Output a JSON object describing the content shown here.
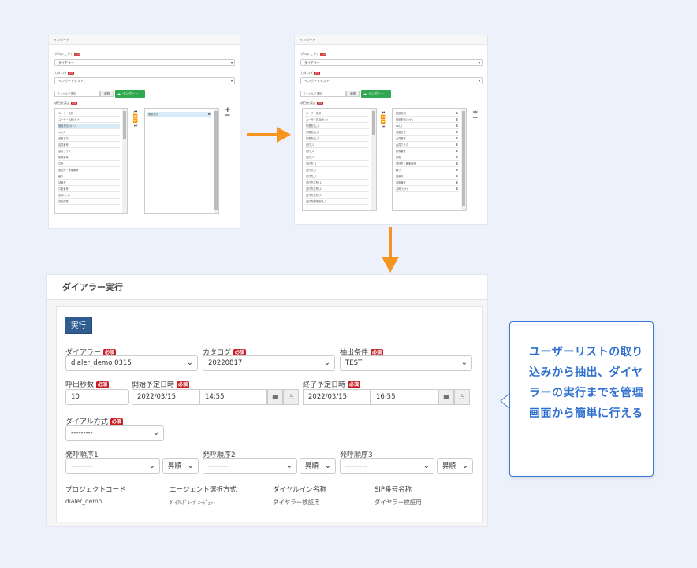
{
  "screen1": {
    "header": "インポート",
    "project_label": "プロジェクト",
    "project_value": "ダイヤラー",
    "catalog_label": "カタログ",
    "catalog_value": "インポートテスト",
    "required": "必須",
    "file_placeholder": "ファイルを選択",
    "browse_label": "参照",
    "import_label": "インポート",
    "mapping_label": "項目を設定",
    "left_items": [
      "ユーザー名称",
      "ユーザー名称(カナ)",
      "施設担当(カナ)",
      "col_1",
      "送客日付",
      "会員番号",
      "会員フラグ",
      "新規番号",
      "住所",
      "発送先・郵便番号",
      "繰り",
      "請番号",
      "口座番号",
      "名称(カナ)",
      "前会所属"
    ],
    "right_items": [
      "施設担当"
    ]
  },
  "screen2": {
    "header": "インポート",
    "project_label": "プロジェクト",
    "project_value": "ダイヤラー",
    "catalog_label": "カタログ",
    "catalog_value": "インポートテスト",
    "required": "必須",
    "file_placeholder": "ファイルを選択",
    "browse_label": "参照",
    "import_label": "インポート",
    "mapping_label": "項目を設定",
    "left_items": [
      "ユーザー名称",
      "ユーザー名称(カナ)",
      "所属担当_1",
      "所属担当_2",
      "所属担当_3",
      "日付_1",
      "日付_2",
      "日付_3",
      "送付先_1",
      "送付先_2",
      "送付先_3",
      "送付先住所_1",
      "送付先住所_2",
      "送付先住所_3",
      "送付先郵便番号_1"
    ],
    "right_items": [
      "施設担当",
      "施設担当(カナ)",
      "col_1",
      "送客日付",
      "会員番号",
      "会員フラグ",
      "新規番号",
      "住所",
      "発送先・郵便番号",
      "繰り",
      "請番号",
      "口座番号",
      "名称(カナ)"
    ]
  },
  "main": {
    "title": "ダイアラー実行",
    "run_button": "実行",
    "required": "必須",
    "dialer_label": "ダイアラー",
    "dialer_value": "dialer_demo 0315",
    "catalog_label": "カタログ",
    "catalog_value": "20220817",
    "condition_label": "抽出条件",
    "condition_value": "TEST",
    "call_seconds_label": "呼出秒数",
    "call_seconds_value": "10",
    "start_label": "開始予定日時",
    "start_date": "2022/03/15",
    "start_time": "14:55",
    "end_label": "終了予定日時",
    "end_date": "2022/03/15",
    "end_time": "16:55",
    "dial_method_label": "ダイアル方式",
    "dial_method_value": "---------",
    "order1_label": "発呼順序1",
    "order2_label": "発呼順序2",
    "order3_label": "発呼順序3",
    "order_value": "---------",
    "order_dir": "昇順",
    "project_code_label": "プロジェクトコード",
    "project_code_value": "dialer_demo",
    "agent_method_label": "エージェント選択方式",
    "agent_method_value": "ﾀﾞｲｱﾙｸﾞﾙｰﾌﾟｴｰｼﾞｪﾝﾄ",
    "dial_in_label": "ダイヤルイン名称",
    "dial_in_value": "ダイヤラー検証用",
    "sip_label": "SIP番号名称",
    "sip_value": "ダイヤラー検証用"
  },
  "callout": {
    "text": "ユーザーリストの取り込みから抽出、ダイヤラーの実行までを管理画面から簡単に行える"
  },
  "colors": {
    "arrow": "#f7941d",
    "callout_border": "#3a78d8",
    "callout_text": "#2e6fd0",
    "required_badge": "#c81d25",
    "run_button": "#2f5c91",
    "import_button": "#2fa84f"
  }
}
